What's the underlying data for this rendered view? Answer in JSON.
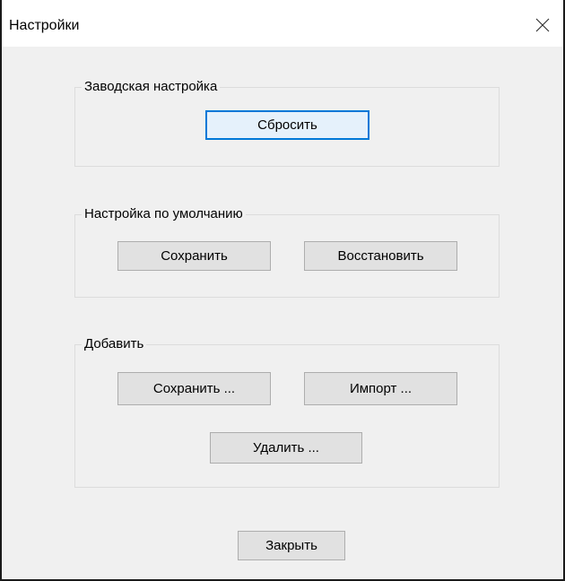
{
  "window": {
    "title": "Настройки",
    "close_icon": "close-icon"
  },
  "groups": {
    "factory": {
      "label": "Заводская настройка",
      "reset_button": "Сбросить"
    },
    "default": {
      "label": "Настройка по умолчанию",
      "save_button": "Сохранить",
      "restore_button": "Восстановить"
    },
    "add": {
      "label": "Добавить",
      "save_button": "Сохранить ...",
      "import_button": "Импорт ...",
      "delete_button": "Удалить ..."
    }
  },
  "footer": {
    "close_button": "Закрыть"
  },
  "colors": {
    "dialog_bg": "#f0f0f0",
    "accent": "#0078d7",
    "button_bg": "#e1e1e1"
  }
}
